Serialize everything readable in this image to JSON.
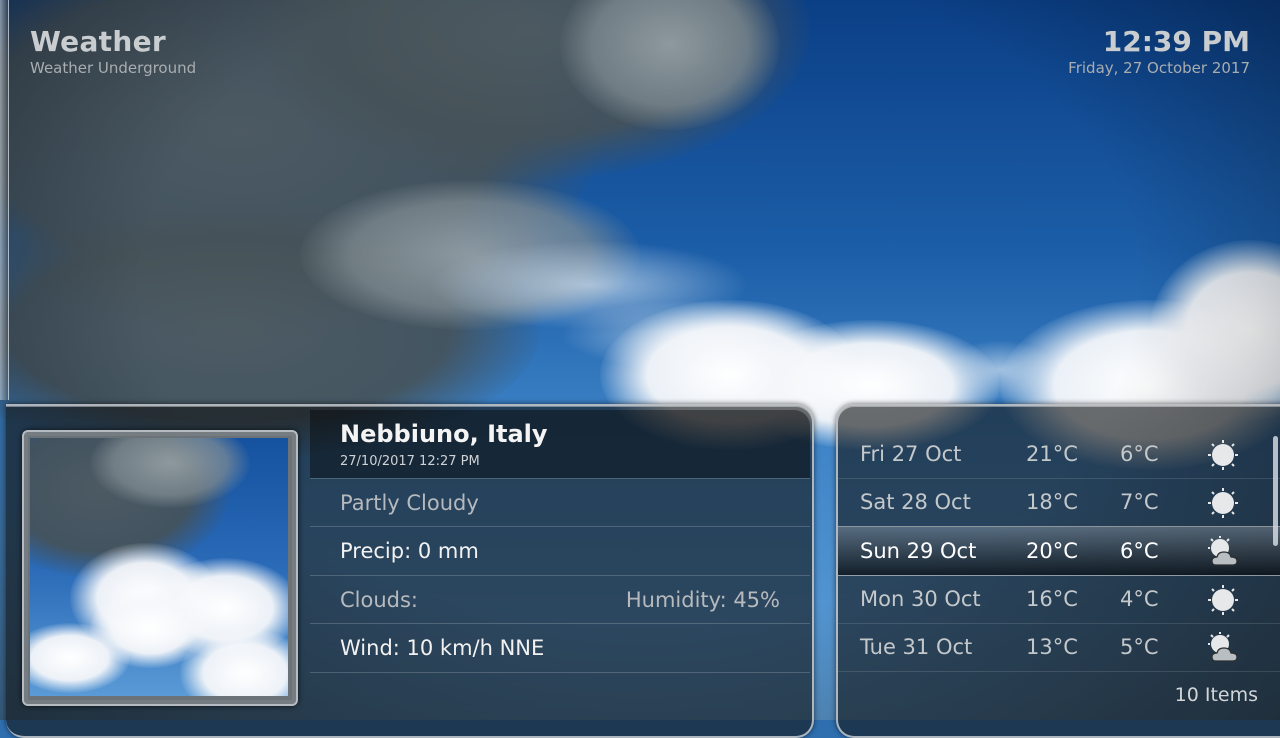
{
  "header": {
    "title": "Weather",
    "subtitle": "Weather Underground",
    "time": "12:39 PM",
    "date": "Friday, 27 October 2017"
  },
  "current": {
    "location": "Nebbiuno, Italy",
    "observed": "27/10/2017 12:27 PM",
    "condition": "Partly Cloudy",
    "precip": "Precip: 0 mm",
    "clouds": "Clouds:",
    "humidity": "Humidity: 45%",
    "wind": "Wind: 10 km/h NNE",
    "thumbnail_icon": "partly-cloudy-sky-image"
  },
  "forecast": [
    {
      "day": "Fri 27 Oct",
      "high": "21°C",
      "low": "6°C",
      "icon": "sun-icon"
    },
    {
      "day": "Sat 28 Oct",
      "high": "18°C",
      "low": "7°C",
      "icon": "sun-icon"
    },
    {
      "day": "Sun 29 Oct",
      "high": "20°C",
      "low": "6°C",
      "icon": "partly-cloudy-icon",
      "selected": true
    },
    {
      "day": "Mon 30 Oct",
      "high": "16°C",
      "low": "4°C",
      "icon": "sun-icon"
    },
    {
      "day": "Tue 31 Oct",
      "high": "13°C",
      "low": "5°C",
      "icon": "partly-cloudy-icon"
    }
  ],
  "list_count": "10 Items",
  "colors": {
    "sky": "#1c5ea8",
    "panel": "#141618",
    "selected_row": "#3a3d40"
  }
}
